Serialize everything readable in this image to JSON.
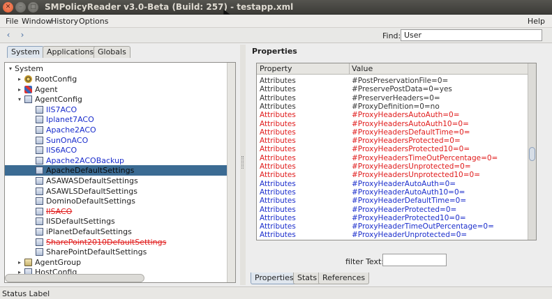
{
  "window": {
    "title": "SMPolicyReader v3.0-Beta (Build: 257) - testapp.xml"
  },
  "menu": {
    "file": "File",
    "window": "Window",
    "history": "History",
    "options": "Options",
    "help": "Help"
  },
  "toolbar": {
    "find_label": "Find:",
    "find_value": "User"
  },
  "left_tabs": [
    {
      "label": "System",
      "active": true
    },
    {
      "label": "Applications",
      "active": false
    },
    {
      "label": "Globals",
      "active": false
    }
  ],
  "tree": {
    "root": "System",
    "items": [
      {
        "label": "RootConfig",
        "expander": "▸",
        "icon": "gear-icon",
        "color": "black"
      },
      {
        "label": "Agent",
        "expander": "▸",
        "icon": "agent-icon",
        "color": "black"
      },
      {
        "label": "AgentConfig",
        "expander": "▾",
        "icon": "document-icon",
        "color": "black"
      },
      {
        "label": "IIS7ACO",
        "icon": "document-icon",
        "color": "blue"
      },
      {
        "label": "Iplanet7ACO",
        "icon": "document-icon",
        "color": "blue"
      },
      {
        "label": "Apache2ACO",
        "icon": "document-icon",
        "color": "blue"
      },
      {
        "label": "SunOnACO",
        "icon": "document-icon",
        "color": "blue"
      },
      {
        "label": "IIS6ACO",
        "icon": "document-icon",
        "color": "blue"
      },
      {
        "label": "Apache2ACOBackup",
        "icon": "document-icon",
        "color": "blue"
      },
      {
        "label": "ApacheDefaultSettings",
        "icon": "document-icon",
        "color": "black",
        "selected": true
      },
      {
        "label": "ASAWASDefaultSettings",
        "icon": "document-icon",
        "color": "black"
      },
      {
        "label": "ASAWLSDefaultSettings",
        "icon": "document-icon",
        "color": "black"
      },
      {
        "label": "DominoDefaultSettings",
        "icon": "document-icon",
        "color": "black"
      },
      {
        "label": "IISACO",
        "icon": "document-icon",
        "color": "red"
      },
      {
        "label": "IISDefaultSettings",
        "icon": "document-icon",
        "color": "black"
      },
      {
        "label": "iPlanetDefaultSettings",
        "icon": "document-icon",
        "color": "black"
      },
      {
        "label": "SharePoint2010DefaultSettings",
        "icon": "document-icon",
        "color": "red"
      },
      {
        "label": "SharePointDefaultSettings",
        "icon": "document-icon",
        "color": "black"
      },
      {
        "label": "AgentGroup",
        "expander": "▸",
        "icon": "folder-icon",
        "color": "black"
      },
      {
        "label": "HostConfig",
        "expander": "▸",
        "icon": "document-icon",
        "color": "black"
      }
    ]
  },
  "properties": {
    "title": "Properties",
    "columns": [
      "Property",
      "Value"
    ],
    "rows": [
      {
        "property": "Attributes",
        "value": "#PostPreservationFile=0=",
        "style": "black"
      },
      {
        "property": "Attributes",
        "value": "#PreservePostData=0=yes",
        "style": "black"
      },
      {
        "property": "Attributes",
        "value": "#PreserverHeaders=0=",
        "style": "black"
      },
      {
        "property": "Attributes",
        "value": "#ProxyDefinition=0=no",
        "style": "black"
      },
      {
        "property": "Attributes",
        "value": "#ProxyHeadersAutoAuth=0=",
        "style": "red"
      },
      {
        "property": "Attributes",
        "value": "#ProxyHeadersAutoAuth10=0=",
        "style": "red"
      },
      {
        "property": "Attributes",
        "value": "#ProxyHeadersDefaultTime=0=",
        "style": "red"
      },
      {
        "property": "Attributes",
        "value": "#ProxyHeadersProtected=0=",
        "style": "red"
      },
      {
        "property": "Attributes",
        "value": "#ProxyHeadersProtected10=0=",
        "style": "red"
      },
      {
        "property": "Attributes",
        "value": "#ProxyHeadersTimeOutPercentage=0=",
        "style": "red"
      },
      {
        "property": "Attributes",
        "value": "#ProxyHeadersUnprotected=0=",
        "style": "red"
      },
      {
        "property": "Attributes",
        "value": "#ProxyHeadersUnprotected10=0=",
        "style": "red"
      },
      {
        "property": "Attributes",
        "value": "#ProxyHeaderAutoAuth=0=",
        "style": "blue"
      },
      {
        "property": "Attributes",
        "value": "#ProxyHeaderAutoAuth10=0=",
        "style": "blue"
      },
      {
        "property": "Attributes",
        "value": "#ProxyHeaderDefaultTime=0=",
        "style": "blue"
      },
      {
        "property": "Attributes",
        "value": "#ProxyHeaderProtected=0=",
        "style": "blue"
      },
      {
        "property": "Attributes",
        "value": "#ProxyHeaderProtected10=0=",
        "style": "blue"
      },
      {
        "property": "Attributes",
        "value": "#ProxyHeaderTimeOutPercentage=0=",
        "style": "blue"
      },
      {
        "property": "Attributes",
        "value": "#ProxyHeaderUnprotected=0=",
        "style": "blue"
      }
    ]
  },
  "filter": {
    "label": "filter Text:",
    "value": ""
  },
  "bottom_tabs": [
    {
      "label": "Properties",
      "active": true
    },
    {
      "label": "Stats",
      "active": false
    },
    {
      "label": "References",
      "active": false
    }
  ],
  "status": {
    "text": "Status Label"
  }
}
